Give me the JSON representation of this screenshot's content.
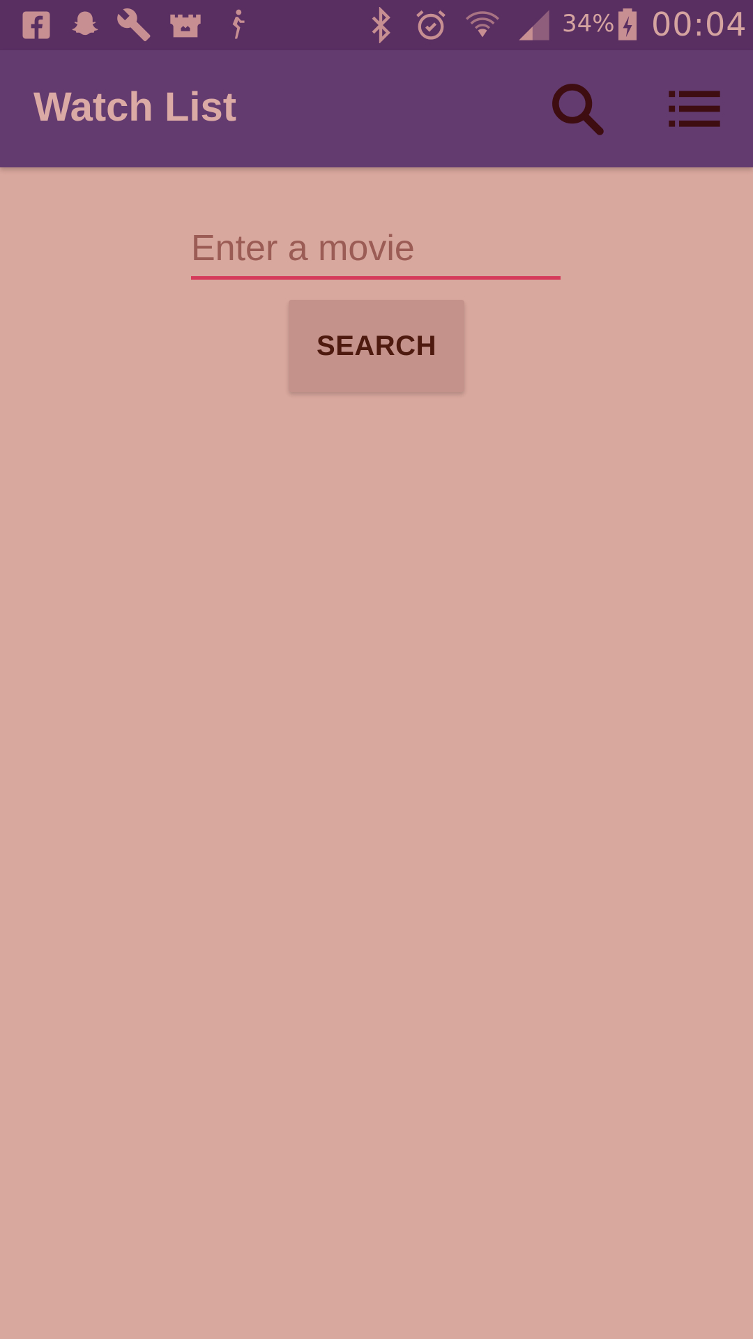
{
  "status_bar": {
    "notification_icons": [
      "facebook-icon",
      "snapchat-icon",
      "wrench-icon",
      "castle-icon",
      "runner-icon"
    ],
    "system_icons": [
      "bluetooth-icon",
      "alarm-icon",
      "wifi-icon",
      "signal-icon",
      "battery-charging-icon"
    ],
    "battery_percent": "34%",
    "time": "00:04"
  },
  "app_bar": {
    "title": "Watch List",
    "actions": [
      "search-icon",
      "list-icon"
    ]
  },
  "search": {
    "placeholder": "Enter a movie",
    "value": "",
    "button_label": "SEARCH"
  },
  "colors": {
    "status_bar": "#592f62",
    "app_bar": "#643b6f",
    "background": "#d8a79d",
    "accent": "#d63a5a",
    "button": "#c4928a",
    "title_text": "#dcaaa4",
    "button_text": "#4e1a10"
  }
}
